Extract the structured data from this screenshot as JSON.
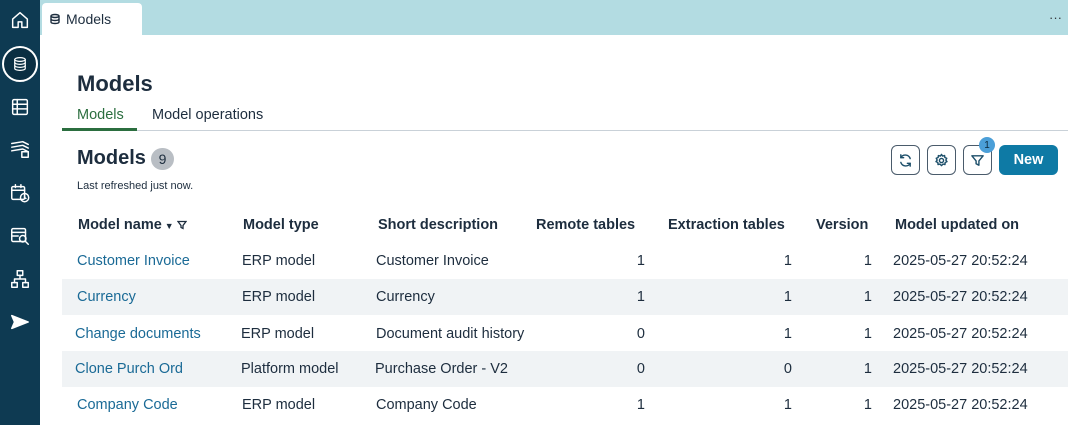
{
  "rail": {
    "items": [
      {
        "name": "home-icon"
      },
      {
        "name": "database-icon"
      },
      {
        "name": "table-icon"
      },
      {
        "name": "layers-icon"
      },
      {
        "name": "calendar-clock-icon"
      },
      {
        "name": "table-search-icon"
      },
      {
        "name": "hierarchy-icon"
      },
      {
        "name": "send-icon"
      }
    ]
  },
  "tabbar": {
    "tab_label": "Models",
    "more": "···"
  },
  "page": {
    "title": "Models"
  },
  "subtabs": [
    "Models",
    "Model operations"
  ],
  "section": {
    "title": "Models",
    "count": "9",
    "refreshed": "Last refreshed just now.",
    "filter_count": "1",
    "new_label": "New"
  },
  "table": {
    "columns": [
      "Model name",
      "Model type",
      "Short description",
      "Remote tables",
      "Extraction tables",
      "Version",
      "Model updated on"
    ],
    "rows": [
      [
        "Customer Invoice",
        "ERP model",
        "Customer Invoice",
        "1",
        "1",
        "1",
        "2025-05-27 20:52:24"
      ],
      [
        "Currency",
        "ERP model",
        "Currency",
        "1",
        "1",
        "1",
        "2025-05-27 20:52:24"
      ],
      [
        "Change documents",
        "ERP model",
        "Document audit history",
        "0",
        "1",
        "1",
        "2025-05-27 20:52:24"
      ],
      [
        "Clone Purch Ord",
        "Platform model",
        "Purchase Order - V2",
        "0",
        "0",
        "1",
        "2025-05-27 20:52:24"
      ],
      [
        "Company Code",
        "ERP model",
        "Company Code",
        "1",
        "1",
        "1",
        "2025-05-27 20:52:24"
      ]
    ]
  },
  "colors": {
    "rail": "#0e3a52",
    "tabbar": "#b3dce2",
    "accent": "#0e7aa5",
    "link": "#1a6a96",
    "active_tab": "#2b6e3f"
  }
}
